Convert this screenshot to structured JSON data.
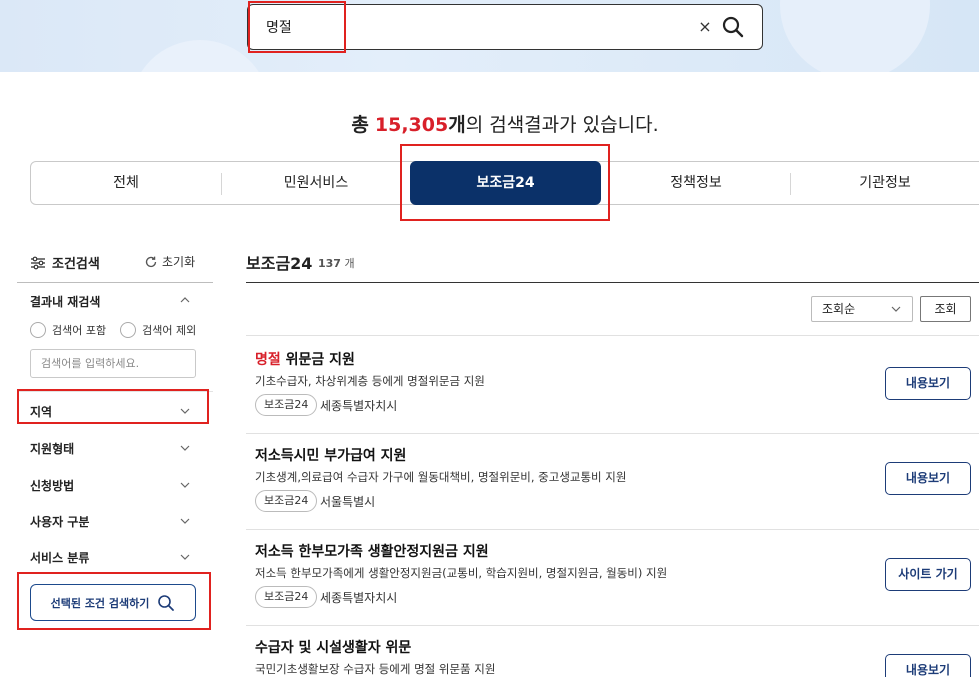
{
  "search": {
    "query": "명절",
    "clear_label": "×"
  },
  "summary": {
    "prefix": "총",
    "count": "15,305",
    "unit": "개",
    "suffix": "의 검색결과가 있습니다."
  },
  "tabs": [
    {
      "label": "전체",
      "active": false
    },
    {
      "label": "민원서비스",
      "active": false
    },
    {
      "label": "보조금24",
      "active": true
    },
    {
      "label": "정책정보",
      "active": false
    },
    {
      "label": "기관정보",
      "active": false
    }
  ],
  "filters": {
    "title": "조건검색",
    "reset_label": "초기화",
    "within": {
      "title": "결과내 재검색",
      "include_label": "검색어 포함",
      "exclude_label": "검색어 제외",
      "placeholder": "검색어를 입력하세요."
    },
    "items": [
      {
        "label": "지역"
      },
      {
        "label": "지원형태"
      },
      {
        "label": "신청방법"
      },
      {
        "label": "사용자 구분"
      },
      {
        "label": "서비스 분류"
      }
    ],
    "submit_label": "선택된 조건 검색하기"
  },
  "results_section": {
    "title": "보조금24",
    "count": "137",
    "count_unit": "개",
    "sort_value": "조회순",
    "sort_button": "조회"
  },
  "results": [
    {
      "title_keyword": "명절",
      "title_rest": " 위문금 지원",
      "desc": "기초수급자, 차상위계층 등에게 명절위문금 지원",
      "badge": "보조금24",
      "region": "세종특별자치시",
      "button": "내용보기"
    },
    {
      "title_keyword": "",
      "title_rest": "저소득시민 부가급여 지원",
      "desc": "기초생계,의료급여 수급자 가구에 월동대책비, 명절위문비, 중고생교통비 지원",
      "badge": "보조금24",
      "region": "서울특별시",
      "button": "내용보기"
    },
    {
      "title_keyword": "",
      "title_rest": "저소득 한부모가족 생활안정지원금 지원",
      "desc": "저소득 한부모가족에게 생활안정지원금(교통비, 학습지원비, 명절지원금, 월동비) 지원",
      "badge": "보조금24",
      "region": "세종특별자치시",
      "button": "사이트 가기"
    },
    {
      "title_keyword": "",
      "title_rest": "수급자 및 시설생활자 위문",
      "desc": "국민기초생활보장 수급자 등에게 명절 위문품 지원",
      "button": "내용보기"
    }
  ],
  "colors": {
    "accent_navy": "#0b3169",
    "keyword_red": "#d8202a",
    "highlight_red": "#e0221f"
  }
}
